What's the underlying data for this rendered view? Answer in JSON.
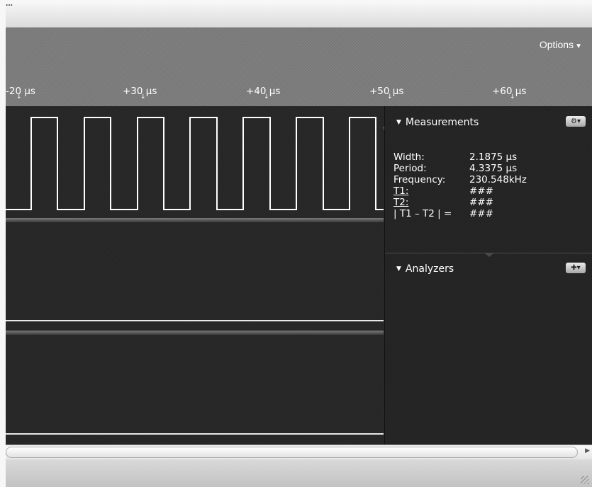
{
  "window": {
    "title_fragment": "...",
    "options_label": "Options",
    "options_caret": "▼"
  },
  "timeline": {
    "ticks": [
      "-20 µs",
      "+30 µs",
      "+40 µs",
      "+50 µs",
      "+60 µs"
    ]
  },
  "waveform": {
    "period_us": 4.3375,
    "width_us": 2.1875,
    "colors": {
      "trace": "#ffffff",
      "background": "#262626"
    }
  },
  "measurements": {
    "title": "Measurements",
    "settings_icon": "gear-icon",
    "rows": [
      {
        "label": "Width:",
        "value": "2.1875 µs"
      },
      {
        "label": "Period:",
        "value": "4.3375 µs"
      },
      {
        "label": "Frequency:",
        "value": "230.548kHz"
      },
      {
        "label": "T1:",
        "value": "###"
      },
      {
        "label": "T2:",
        "value": "###"
      },
      {
        "label": "| T1 – T2 | =",
        "value": "###"
      }
    ]
  },
  "analyzers": {
    "title": "Analyzers",
    "add_icon": "plus-icon"
  }
}
